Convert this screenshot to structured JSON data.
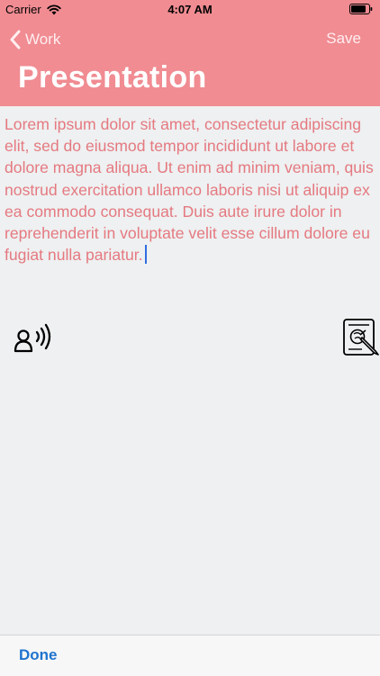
{
  "status_bar": {
    "carrier": "Carrier",
    "time": "4:07 AM"
  },
  "nav": {
    "back_label": "Work",
    "save_label": "Save",
    "title": "Presentation"
  },
  "editor": {
    "text": "Lorem ipsum dolor sit amet, consectetur adipiscing elit, sed do eiusmod tempor incididunt ut labore et dolore magna aliqua. Ut enim ad minim veniam, quis nostrud exercitation ullamco laboris nisi ut aliquip ex ea commodo consequat. Duis aute irure dolor in reprehenderit in voluptate velit esse cillum dolore eu fugiat nulla pariatur."
  },
  "toolbar": {
    "done_label": "Done"
  },
  "icons": {
    "back": "chevron-left-icon",
    "speak": "speak-icon",
    "document_edit": "document-edit-icon",
    "wifi": "wifi-icon",
    "battery": "battery-icon"
  },
  "colors": {
    "header_bg": "#f08c92",
    "body_text": "#e57980",
    "background": "#eef0f1",
    "done": "#1f73cf",
    "caret": "#2f6ee0"
  }
}
